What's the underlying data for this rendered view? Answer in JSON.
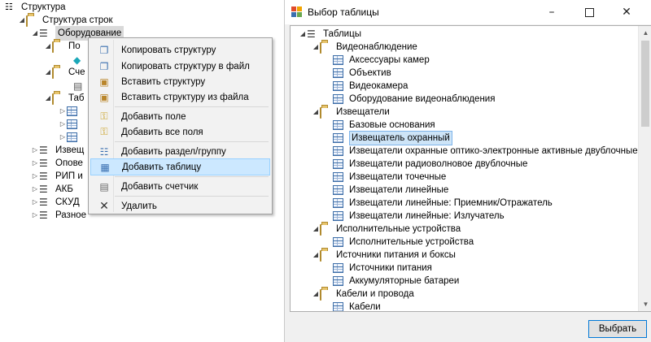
{
  "left_tree": {
    "root": "Структура",
    "struct_rows": "Структура строк",
    "equipment": "Оборудование",
    "sub1": "По",
    "sub2": "Сче",
    "sub3": "Таб",
    "items": [
      "Извещ",
      "Опове",
      "РИП и",
      "АКБ",
      "СКУД",
      "Разное"
    ]
  },
  "context_menu": {
    "items": [
      {
        "label": "Копировать структуру",
        "icon": "copy-icon"
      },
      {
        "label": "Копировать структуру в файл",
        "icon": "copy-to-file-icon"
      },
      {
        "label": "Вставить структуру",
        "icon": "paste-icon"
      },
      {
        "label": "Вставить структуру из файла",
        "icon": "paste-from-file-icon"
      },
      {
        "label": "Добавить поле",
        "icon": "add-field-icon"
      },
      {
        "label": "Добавить все поля",
        "icon": "add-all-fields-icon"
      },
      {
        "label": "Добавить раздел/группу",
        "icon": "add-section-icon"
      },
      {
        "label": "Добавить таблицу",
        "icon": "add-table-icon"
      },
      {
        "label": "Добавить счетчик",
        "icon": "add-counter-icon"
      },
      {
        "label": "Удалить",
        "icon": "delete-icon"
      }
    ]
  },
  "dialog": {
    "title": "Выбор таблицы",
    "ok_button": "Выбрать",
    "root": "Таблицы",
    "tree": [
      {
        "type": "folder",
        "label": "Видеонаблюдение"
      },
      {
        "type": "table",
        "label": "Аксессуары камер"
      },
      {
        "type": "table",
        "label": "Объектив"
      },
      {
        "type": "table",
        "label": "Видеокамера"
      },
      {
        "type": "table",
        "label": "Оборудование видеонаблюдения"
      },
      {
        "type": "folder",
        "label": "Извещатели"
      },
      {
        "type": "table",
        "label": "Базовые основания"
      },
      {
        "type": "table",
        "label": "Извещатель охранный",
        "selected": true
      },
      {
        "type": "table",
        "label": "Извещатели охранные оптико-электронные активные двублочные"
      },
      {
        "type": "table",
        "label": "Извещатели радиоволновое двублочные"
      },
      {
        "type": "table",
        "label": "Извещатели точечные"
      },
      {
        "type": "table",
        "label": "Извещатели линейные"
      },
      {
        "type": "table",
        "label": "Извещатели линейные: Приемник/Отражатель"
      },
      {
        "type": "table",
        "label": "Извещатели линейные: Излучатель"
      },
      {
        "type": "folder",
        "label": "Исполнительные устройства"
      },
      {
        "type": "table",
        "label": "Исполнительные устройства"
      },
      {
        "type": "folder",
        "label": "Источники питания и боксы"
      },
      {
        "type": "table",
        "label": "Источники питания"
      },
      {
        "type": "table",
        "label": "Аккумуляторные батареи"
      },
      {
        "type": "folder",
        "label": "Кабели и провода"
      },
      {
        "type": "table",
        "label": "Кабели"
      }
    ]
  }
}
